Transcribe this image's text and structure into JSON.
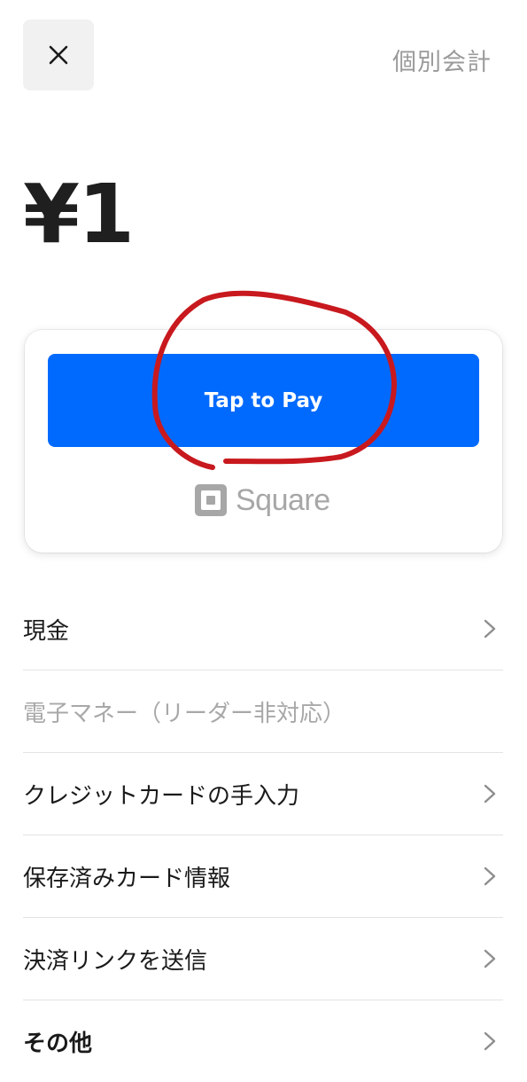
{
  "header": {
    "close_icon": "close-icon",
    "split_label": "個別会計"
  },
  "amount": {
    "value": "¥1"
  },
  "pay_card": {
    "tap_button_label": "Tap to Pay",
    "brand_icon": "square-logo-icon",
    "brand_label": "Square"
  },
  "annotation": {
    "color": "#c8191e",
    "description_icon": "red-circle-annotation"
  },
  "methods": [
    {
      "label": "現金",
      "enabled": true,
      "bold": false,
      "chevron": true
    },
    {
      "label": "電子マネー（リーダー非対応）",
      "enabled": false,
      "bold": false,
      "chevron": false
    },
    {
      "label": "クレジットカードの手入力",
      "enabled": true,
      "bold": false,
      "chevron": true
    },
    {
      "label": "保存済みカード情報",
      "enabled": true,
      "bold": false,
      "chevron": true
    },
    {
      "label": "決済リンクを送信",
      "enabled": true,
      "bold": false,
      "chevron": true
    },
    {
      "label": "その他",
      "enabled": true,
      "bold": true,
      "chevron": true
    }
  ],
  "colors": {
    "accent": "#006aff",
    "muted_text": "#9a9a9a",
    "divider": "#e3e3e3"
  }
}
